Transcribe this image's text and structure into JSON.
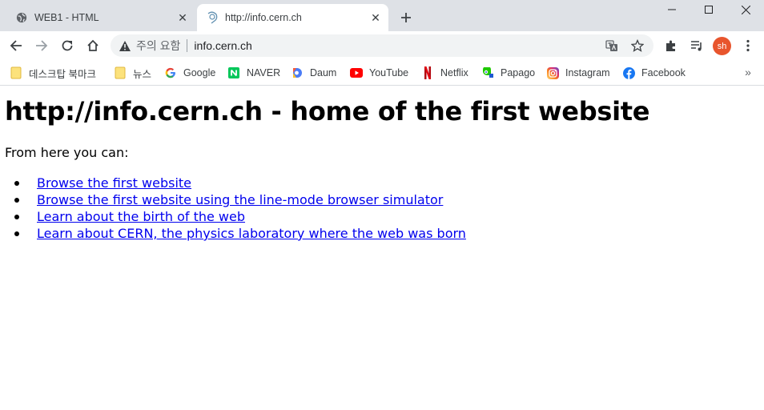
{
  "tabs": [
    {
      "title": "WEB1 - HTML",
      "icon": "globe-icon",
      "active": false
    },
    {
      "title": "http://info.cern.ch",
      "icon": "loading-icon",
      "active": true
    }
  ],
  "toolbar": {
    "security_label": "주의 요함",
    "url": "info.cern.ch",
    "avatar_initials": "sh",
    "avatar_color": "#e8552d"
  },
  "bookmarks": [
    {
      "label": "데스크탑 북마크",
      "icon": "folder-icon"
    },
    {
      "label": "뉴스",
      "icon": "folder-icon"
    },
    {
      "label": "Google",
      "icon": "google-icon"
    },
    {
      "label": "NAVER",
      "icon": "naver-icon"
    },
    {
      "label": "Daum",
      "icon": "daum-icon"
    },
    {
      "label": "YouTube",
      "icon": "youtube-icon"
    },
    {
      "label": "Netflix",
      "icon": "netflix-icon"
    },
    {
      "label": "Papago",
      "icon": "papago-icon"
    },
    {
      "label": "Instagram",
      "icon": "instagram-icon"
    },
    {
      "label": "Facebook",
      "icon": "facebook-icon"
    }
  ],
  "page": {
    "heading": "http://info.cern.ch - home of the first website",
    "intro": "From here you can:",
    "links": [
      "Browse the first website",
      "Browse the first website using the line-mode browser simulator",
      "Learn about the birth of the web",
      "Learn about CERN, the physics laboratory where the web was born"
    ]
  },
  "colors": {
    "tabstrip_bg": "#dee1e6",
    "link": "#0000ee"
  }
}
